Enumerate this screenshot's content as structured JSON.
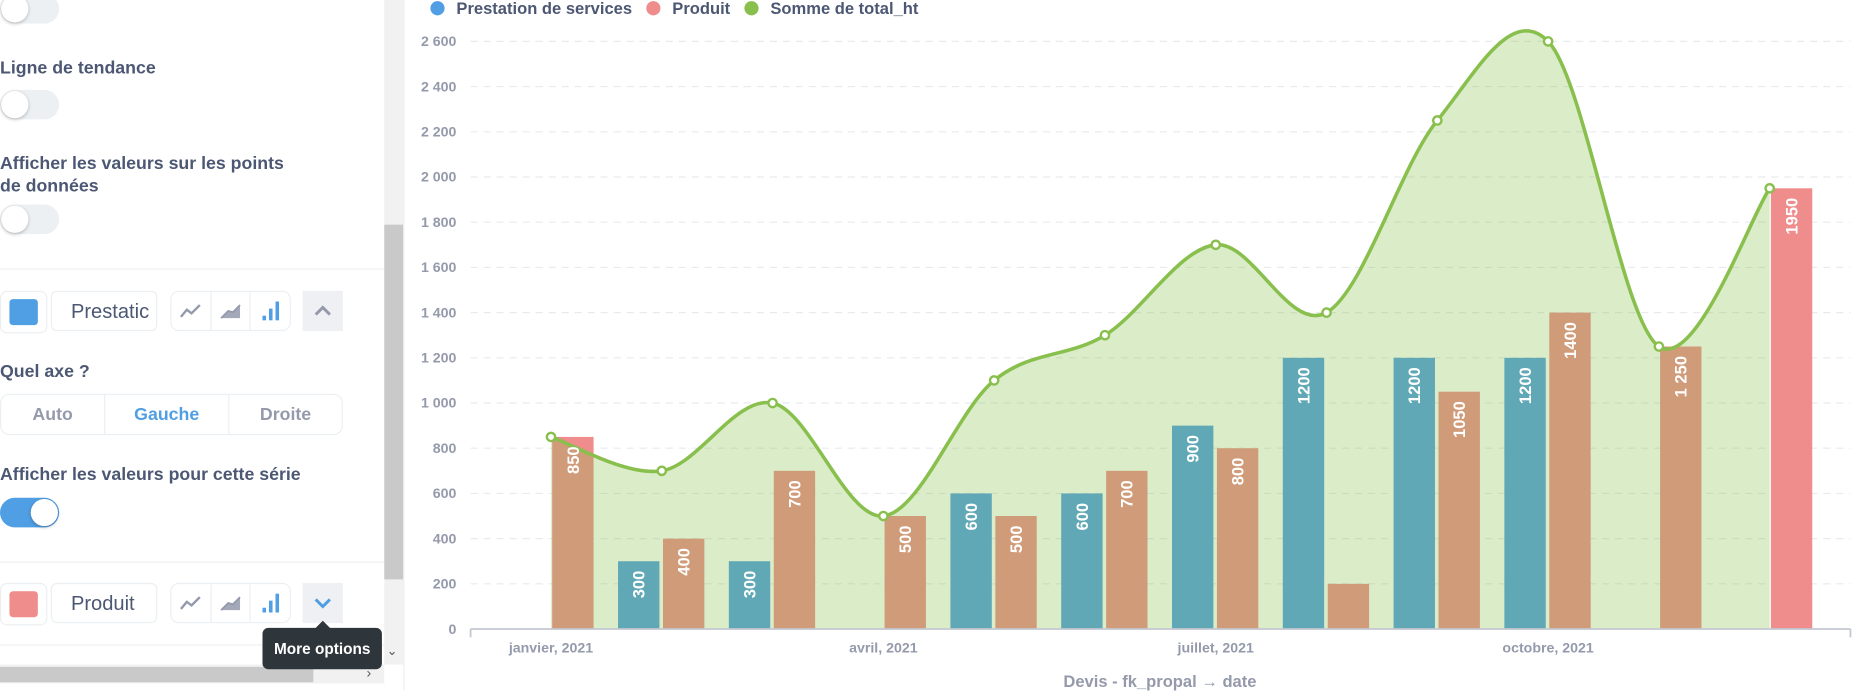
{
  "settings": {
    "toggle_top_on": false,
    "trendline_label": "Ligne de tendance",
    "trendline_on": false,
    "show_values_points_label": "Afficher les valeurs sur les points de données",
    "show_values_points_on": false,
    "series": [
      {
        "name": "Prestatic",
        "color": "#509ee3",
        "expanded": true,
        "active_type": "bar"
      },
      {
        "name": "Produit",
        "color": "#ef8c8c",
        "expanded": false,
        "active_type": "bar"
      }
    ],
    "axis_label": "Quel axe ?",
    "axis_options": [
      "Auto",
      "Gauche",
      "Droite"
    ],
    "axis_selected": "Gauche",
    "show_series_values_label": "Afficher les valeurs pour cette série",
    "show_series_values_on": true,
    "tooltip": "More options"
  },
  "chart_data": {
    "type": "bar",
    "xlabel": "Devis - fk_propal → date",
    "ylabel": "",
    "ylim": [
      0,
      2600
    ],
    "yticks": [
      0,
      200,
      400,
      600,
      800,
      1000,
      1200,
      1400,
      1600,
      1800,
      2000,
      2200,
      2400,
      2600
    ],
    "ytick_labels": [
      "0",
      "200",
      "400",
      "600",
      "800",
      "1 000",
      "1 200",
      "1 400",
      "1 600",
      "1 800",
      "2 000",
      "2 200",
      "2 400",
      "2 600"
    ],
    "categories": [
      "2021-01",
      "2021-02",
      "2021-03",
      "2021-04",
      "2021-05",
      "2021-06",
      "2021-07",
      "2021-08",
      "2021-09",
      "2021-10",
      "2021-11",
      "2021-12"
    ],
    "xtick_labels": [
      {
        "category": "2021-01",
        "label": "janvier, 2021"
      },
      {
        "category": "2021-04",
        "label": "avril, 2021"
      },
      {
        "category": "2021-07",
        "label": "juillet, 2021"
      },
      {
        "category": "2021-10",
        "label": "octobre, 2021"
      }
    ],
    "grid": true,
    "legend_position": "top-left",
    "series": [
      {
        "name": "Prestation de services",
        "kind": "bar",
        "color": "#509ee3",
        "show_labels": true,
        "values": [
          null,
          300,
          300,
          null,
          600,
          600,
          900,
          1200,
          1200,
          1200,
          null,
          null
        ],
        "labels": [
          null,
          "300",
          "300",
          null,
          "600",
          "600",
          "900",
          "1200",
          "1200",
          "1200",
          null,
          null
        ]
      },
      {
        "name": "Produit",
        "kind": "bar",
        "color": "#ef8c8c",
        "show_labels": true,
        "values": [
          850,
          400,
          700,
          500,
          500,
          700,
          800,
          200,
          1050,
          1400,
          1250,
          1950
        ],
        "labels": [
          "850",
          "400",
          "700",
          "500",
          "500",
          "700",
          "800",
          null,
          "1050",
          "1400",
          "1 250",
          "1950"
        ]
      },
      {
        "name": "Somme de total_ht",
        "kind": "area",
        "color": "#88bf4d",
        "show_labels": false,
        "values": [
          850,
          700,
          1000,
          500,
          1100,
          1300,
          1700,
          1400,
          2250,
          2600,
          1250,
          1950
        ]
      }
    ]
  }
}
